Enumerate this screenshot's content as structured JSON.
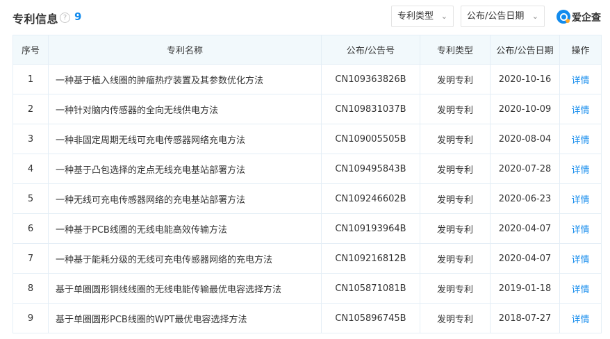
{
  "header": {
    "title": "专利信息",
    "help_icon": "?",
    "count": "9",
    "filters": {
      "type_label": "专利类型",
      "date_label": "公布/公告日期"
    },
    "brand": "爱企查",
    "accent_color": "#128bed"
  },
  "table": {
    "columns": [
      "序号",
      "专利名称",
      "公布/公告号",
      "专利类型",
      "公布/公告日期",
      "操作"
    ],
    "rows": [
      {
        "no": "1",
        "name": "一种基于植入线圈的肿瘤热疗装置及其参数优化方法",
        "pub_no": "CN109363826B",
        "type": "发明专利",
        "date": "2020-10-16",
        "op": "详情"
      },
      {
        "no": "2",
        "name": "一种针对脑内传感器的全向无线供电方法",
        "pub_no": "CN109831037B",
        "type": "发明专利",
        "date": "2020-10-09",
        "op": "详情"
      },
      {
        "no": "3",
        "name": "一种非固定周期无线可充电传感器网络充电方法",
        "pub_no": "CN109005505B",
        "type": "发明专利",
        "date": "2020-08-04",
        "op": "详情"
      },
      {
        "no": "4",
        "name": "一种基于凸包选择的定点无线充电基站部署方法",
        "pub_no": "CN109495843B",
        "type": "发明专利",
        "date": "2020-07-28",
        "op": "详情"
      },
      {
        "no": "5",
        "name": "一种无线可充电传感器网络的充电基站部署方法",
        "pub_no": "CN109246602B",
        "type": "发明专利",
        "date": "2020-06-23",
        "op": "详情"
      },
      {
        "no": "6",
        "name": "一种基于PCB线圈的无线电能高效传输方法",
        "pub_no": "CN109193964B",
        "type": "发明专利",
        "date": "2020-04-07",
        "op": "详情"
      },
      {
        "no": "7",
        "name": "一种基于能耗分级的无线可充电传感器网络的充电方法",
        "pub_no": "CN109216812B",
        "type": "发明专利",
        "date": "2020-04-07",
        "op": "详情"
      },
      {
        "no": "8",
        "name": "基于单圈圆形铜线线圈的无线电能传输最优电容选择方法",
        "pub_no": "CN105871081B",
        "type": "发明专利",
        "date": "2019-01-18",
        "op": "详情"
      },
      {
        "no": "9",
        "name": "基于单圈圆形PCB线圈的WPT最优电容选择方法",
        "pub_no": "CN105896745B",
        "type": "发明专利",
        "date": "2018-07-27",
        "op": "详情"
      }
    ]
  }
}
